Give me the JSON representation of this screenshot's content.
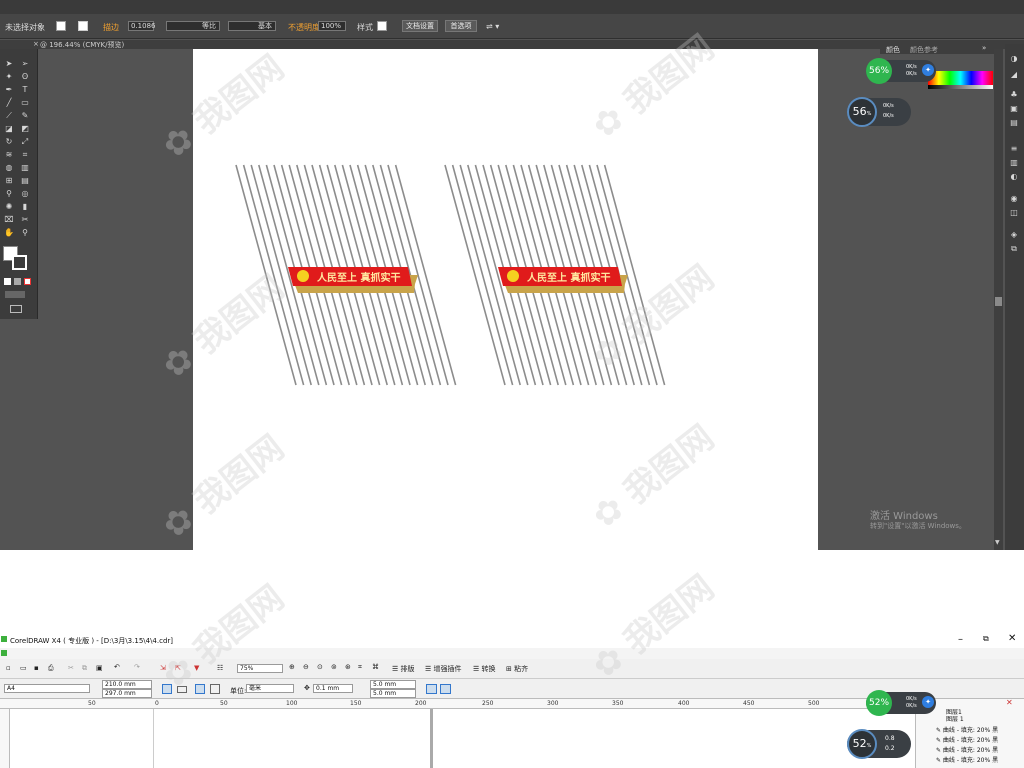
{
  "illustrator": {
    "control": {
      "selection_label": "未选择对象",
      "stroke_label": "描边",
      "stroke_width": "0.1086",
      "profile_label": "等比",
      "brush_label": "基本",
      "opacity_label": "不透明度",
      "opacity_value": "100%",
      "style_label": "样式",
      "doc_setup": "文档设置",
      "prefs": "首选项"
    },
    "doc_tab": "@ 196.44% (CMYK/预览)",
    "panel": {
      "color_tab": "颜色",
      "color_ref_tab": "颜色参考"
    },
    "gauges": {
      "top_percent": "56",
      "top_l1": "0K/s",
      "top_l2": "0K/s",
      "mid_percent": "56",
      "mid_l1": "0K/s",
      "mid_l2": "0K/s"
    },
    "activate": {
      "line1": "激活 Windows",
      "line2": "转到\"设置\"以激活 Windows。"
    },
    "banner_text": "人民至上  真抓实干",
    "colors": {
      "banner_red": "#e01b1b",
      "banner_gold": "#c9a44a",
      "stripe": "#8c8c8c"
    }
  },
  "coreldraw": {
    "title": "CorelDRAW X4 ( 专业版 ) - [D:\\3月\\3.15\\4\\4.cdr]",
    "zoom": "75%",
    "toolbar": {
      "sort": "排版",
      "enhance": "增强插件",
      "convert": "转换",
      "paste": "粘齐"
    },
    "page_size": "A4",
    "width": "210.0 mm",
    "height": "297.0 mm",
    "unit_label": "单位:",
    "unit_value": "毫米",
    "nudge": "0.1 mm",
    "dup_x": "5.0 mm",
    "dup_y": "5.0 mm",
    "ruler": [
      "50",
      "0",
      "50",
      "100",
      "150",
      "200",
      "250",
      "300",
      "350",
      "400",
      "450",
      "500"
    ],
    "gauges": {
      "top_percent": "52",
      "top_l1": "0K/s",
      "top_l2": "0K/s",
      "mid_percent": "52",
      "mid_l1": "0.8",
      "mid_l2": "0.2"
    },
    "objects": {
      "layer1": "图层1",
      "layer2": "图层 1",
      "items": [
        "曲线 - 填充: 20% 黑",
        "曲线 - 填充: 20% 黑",
        "曲线 - 填充: 20% 黑",
        "曲线 - 填充: 20% 黑"
      ]
    }
  }
}
